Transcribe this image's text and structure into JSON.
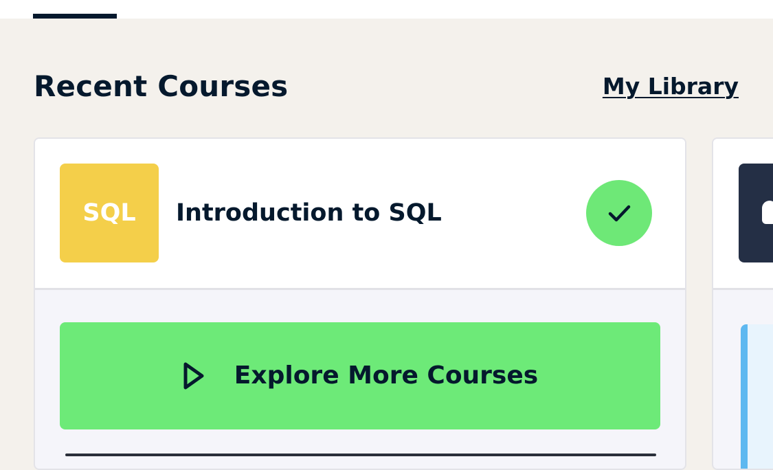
{
  "section": {
    "title": "Recent Courses",
    "library_link": "My Library"
  },
  "course": {
    "badge_text": "SQL",
    "title": "Introduction to SQL",
    "status_icon": "checkmark-icon",
    "badge_color": "#f4cf4a",
    "status_color": "#6ee877"
  },
  "cta": {
    "label": "Explore More Courses",
    "icon": "play-icon",
    "color": "#6dea78"
  },
  "next_course": {
    "badge_color": "#242f45",
    "panel_accent": "#5eb8f0"
  },
  "colors": {
    "text": "#05192d",
    "page_bg": "#f4f1ec"
  }
}
